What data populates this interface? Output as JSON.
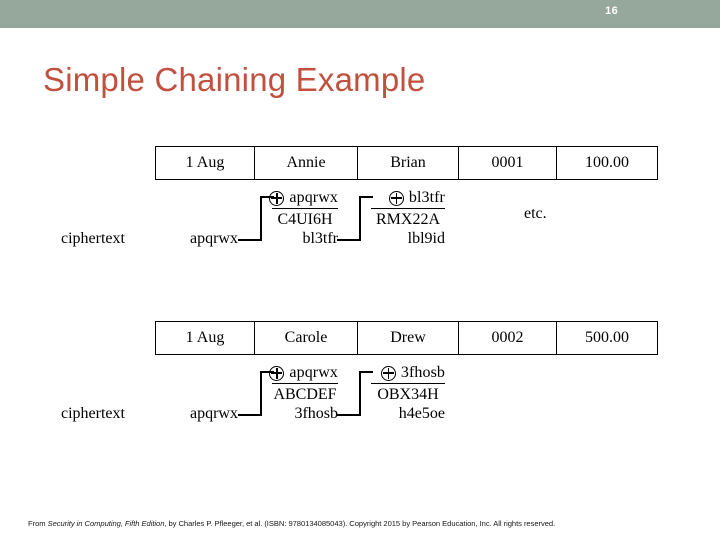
{
  "slide": {
    "number": "16",
    "title": "Simple Chaining Example",
    "header_color": "#96a79c",
    "title_color": "#c0513e"
  },
  "diagram": {
    "etc_label": "etc.",
    "xor_icon": "circled-plus-icon",
    "blocks": [
      {
        "id": "transaction-1",
        "ciphertext_label": "ciphertext",
        "ciphertext_value": "apqrwx",
        "record": {
          "date": "1 Aug",
          "from": "Annie",
          "to": "Brian",
          "account": "0001",
          "amount": "100.00"
        },
        "steps": [
          {
            "operand": "apqrwx",
            "plaintext": "C4UI6H",
            "result": "bl3tfr"
          },
          {
            "operand": "bl3tfr",
            "plaintext": "RMX22A",
            "result": "lbl9id"
          }
        ]
      },
      {
        "id": "transaction-2",
        "ciphertext_label": "ciphertext",
        "ciphertext_value": "apqrwx",
        "record": {
          "date": "1 Aug",
          "from": "Carole",
          "to": "Drew",
          "account": "0002",
          "amount": "500.00"
        },
        "steps": [
          {
            "operand": "apqrwx",
            "plaintext": "ABCDEF",
            "result": "3fhosb"
          },
          {
            "operand": "3fhosb",
            "plaintext": "OBX34H",
            "result": "h4e5oe"
          }
        ]
      }
    ]
  },
  "footer": {
    "prefix": "From ",
    "book_title": "Security in Computing, Fifth Edition",
    "suffix": ", by Charles P. Pfleeger, et al. (ISBN: 9780134085043). Copyright 2015 by Pearson Education, Inc. All rights reserved."
  }
}
